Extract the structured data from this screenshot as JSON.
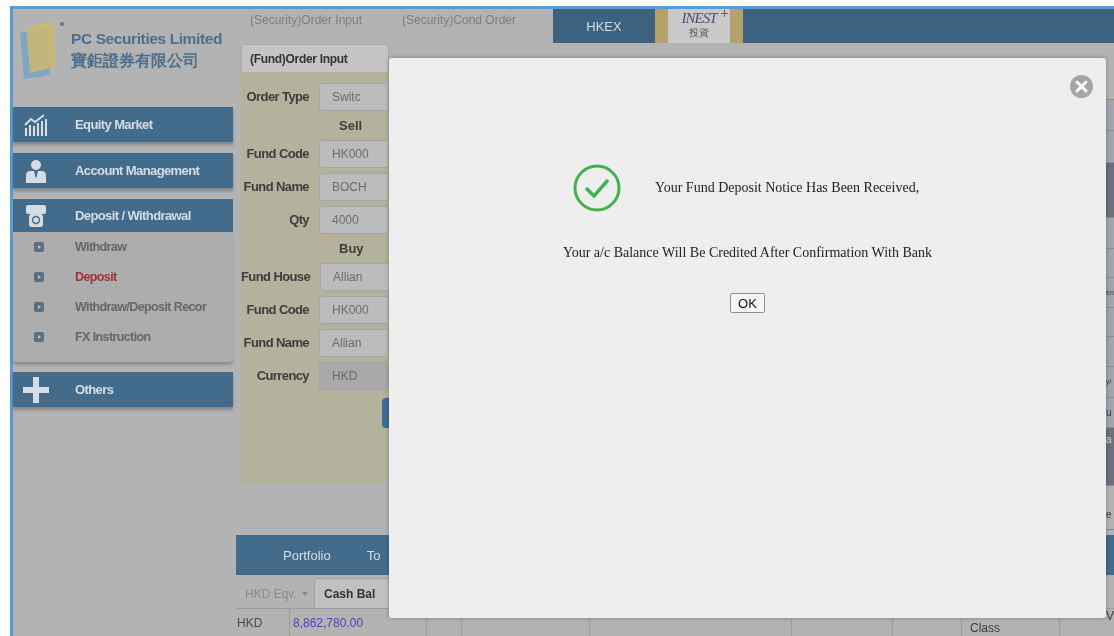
{
  "company": {
    "name": "PC Securities Limited",
    "name_zh": "寶鉅證券有限公司"
  },
  "top_tabs": [
    {
      "label": "(Security)Order Input"
    },
    {
      "label": "(Security)Cond Order"
    }
  ],
  "market_tab": {
    "label": "HKEX"
  },
  "partner_logo": {
    "text": "INEST",
    "subtext": "投資"
  },
  "nav": [
    {
      "label": "Equity Market",
      "expanded": false
    },
    {
      "label": "Account Management",
      "expanded": false
    },
    {
      "label": "Deposit / Withdrawal",
      "expanded": true,
      "children": [
        {
          "label": "Withdraw",
          "selected": false
        },
        {
          "label": "Deposit",
          "selected": true
        },
        {
          "label": "Withdraw/Deposit Recor",
          "selected": false
        },
        {
          "label": "FX Instruction",
          "selected": false
        }
      ]
    },
    {
      "label": "Others",
      "expanded": false
    }
  ],
  "order_form": {
    "tab": "(Fund)Order Input",
    "rows": [
      {
        "kind": "field",
        "label": "Order Type",
        "value": "Switc",
        "disabled": false
      },
      {
        "kind": "heading",
        "label": "Sell"
      },
      {
        "kind": "field",
        "label": "Fund Code",
        "value": "HK000",
        "disabled": false
      },
      {
        "kind": "field",
        "label": "Fund Name",
        "value": "BOCH",
        "disabled": false
      },
      {
        "kind": "field",
        "label": "Qty",
        "value": "4000",
        "disabled": false
      },
      {
        "kind": "heading",
        "label": "Buy"
      },
      {
        "kind": "field",
        "label": "Fund House",
        "value": "Allian",
        "disabled": false
      },
      {
        "kind": "field",
        "label": "Fund Code",
        "value": "HK000",
        "disabled": false
      },
      {
        "kind": "field",
        "label": "Fund Name",
        "value": "Allian",
        "disabled": false
      },
      {
        "kind": "field",
        "label": "Currency",
        "value": "HKD",
        "disabled": true
      }
    ]
  },
  "right_edge_fragments": [
    "en",
    "y/",
    "u",
    "a",
    "e"
  ],
  "portfolio_tabs": [
    {
      "label": "Portfolio"
    },
    {
      "label": "To"
    }
  ],
  "currency_select": "HKD Eqv.",
  "balance_tab": "Cash Bal",
  "balance_table": {
    "cells": [
      "HKD",
      "8,862,780.00"
    ],
    "column_header": "Class",
    "edge_text": "V"
  },
  "dialog": {
    "lines": [
      "Your Fund Deposit Notice Has Been Received,",
      "Your a/c Balance Will Be Credited After Confirmation With Bank"
    ],
    "button": "OK"
  }
}
